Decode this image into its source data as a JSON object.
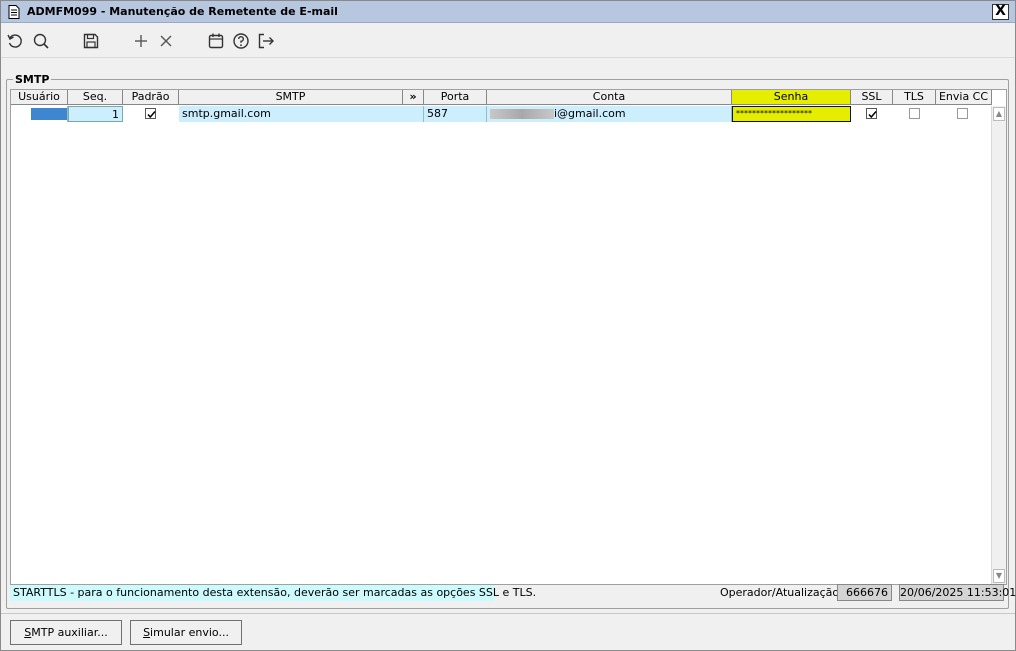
{
  "window": {
    "title": "ADMFM099 - Manutenção de Remetente de E-mail",
    "close_label": "X"
  },
  "toolbar": {
    "icons": [
      "refresh-icon",
      "search-icon",
      "save-icon",
      "add-icon",
      "delete-icon",
      "calendar-icon",
      "help-icon",
      "exit-icon"
    ]
  },
  "group": {
    "label": "SMTP"
  },
  "grid": {
    "columns": [
      "Usuário",
      "Seq.",
      "Padrão",
      "SMTP",
      "»",
      "Porta",
      "Conta",
      "Senha",
      "SSL",
      "TLS",
      "Envia CC"
    ],
    "row": {
      "seq": "1",
      "padrao": true,
      "smtp": "smtp.gmail.com",
      "porta": "587",
      "conta_suffix": "i@gmail.com",
      "senha": "*******************",
      "ssl": true,
      "tls": false,
      "envia_cc": false
    }
  },
  "hint": "STARTTLS - para o funcionamento desta extensão, deverão ser marcadas as opções SSL e TLS.",
  "footer": {
    "operator_label": "Operador/Atualização",
    "operator_id": "666676",
    "updated_at": "20/06/2025 11:53:01"
  },
  "buttons": {
    "smtp_aux_prefix": "S",
    "smtp_aux_rest": "MTP auxiliar...",
    "simulate_prefix": "S",
    "simulate_rest": "imular envio..."
  },
  "colors": {
    "title_bar": "#b8c7e0",
    "selected_row": "#cdeefc",
    "highlight_column": "#e6ee00",
    "hint_bg": "#cdfbfd"
  }
}
